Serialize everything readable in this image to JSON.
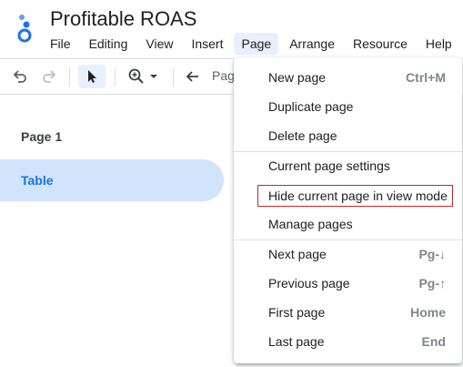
{
  "app": {
    "title": "Profitable ROAS"
  },
  "menubar": {
    "items": [
      {
        "label": "File"
      },
      {
        "label": "Editing"
      },
      {
        "label": "View"
      },
      {
        "label": "Insert"
      },
      {
        "label": "Page"
      },
      {
        "label": "Arrange"
      },
      {
        "label": "Resource"
      },
      {
        "label": "Help"
      }
    ]
  },
  "toolbar": {
    "undo_icon": "undo-icon",
    "redo_icon": "redo-icon",
    "select_icon": "pointer-icon",
    "zoom_icon": "zoom-in-icon",
    "back_icon": "arrow-left-icon",
    "page_nav_text": "Pag"
  },
  "pages": {
    "items": [
      {
        "label": "Page 1",
        "selected": false
      },
      {
        "label": "Table",
        "selected": true
      }
    ]
  },
  "page_menu": {
    "items": [
      {
        "label": "New page",
        "shortcut": "Ctrl+M"
      },
      {
        "label": "Duplicate page",
        "shortcut": ""
      },
      {
        "label": "Delete page",
        "shortcut": ""
      },
      {
        "label": "Current page settings",
        "shortcut": ""
      },
      {
        "label": "Hide current page in view mode",
        "shortcut": ""
      },
      {
        "label": "Manage pages",
        "shortcut": ""
      },
      {
        "label": "Next page",
        "shortcut": "Pg-↓"
      },
      {
        "label": "Previous page",
        "shortcut": "Pg-↑"
      },
      {
        "label": "First page",
        "shortcut": "Home"
      },
      {
        "label": "Last page",
        "shortcut": "End"
      }
    ]
  },
  "colors": {
    "accent": "#1a73e8",
    "selected_bg": "#d2e3fc",
    "highlight_border": "#c62828"
  }
}
